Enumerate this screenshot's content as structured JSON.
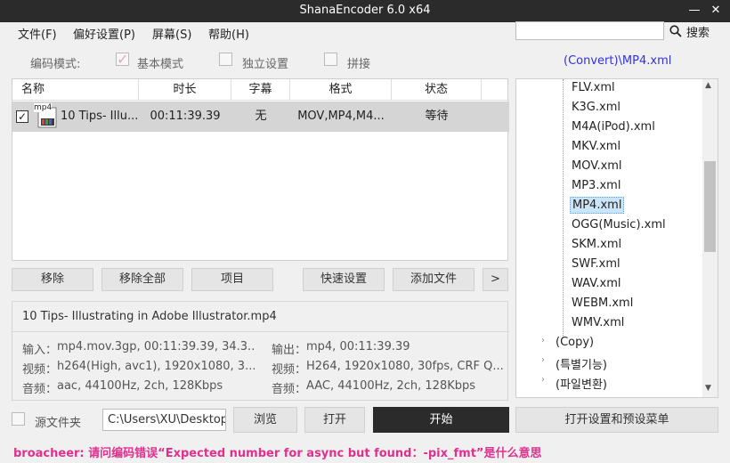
{
  "window": {
    "title": "ShanaEncoder 6.0 x64",
    "minimize": "—",
    "close": "✕"
  },
  "menu": {
    "items": [
      "文件(F)",
      "偏好设置(P)",
      "屏幕(S)",
      "帮助(H)"
    ],
    "search_label": "搜索"
  },
  "mode": {
    "label": "编码模式:",
    "options": [
      {
        "label": "基本模式",
        "checked": true
      },
      {
        "label": "独立设置",
        "checked": false
      },
      {
        "label": "拼接",
        "checked": false
      }
    ]
  },
  "preset_path": "(Convert)\\MP4.xml",
  "table": {
    "headers": [
      "名称",
      "时长",
      "字幕",
      "格式",
      "状态"
    ],
    "rows": [
      {
        "name": "10 Tips- Illu...",
        "duration": "00:11:39.39",
        "subtitle": "无",
        "format": "MOV,MP4,M4...",
        "status": "等待",
        "icon_label": "mp4",
        "checked": true
      }
    ]
  },
  "actions": {
    "remove": "移除",
    "remove_all": "移除全部",
    "item": "项目",
    "quick_settings": "快速设置",
    "add_file": "添加文件",
    "more": ">"
  },
  "info": {
    "filename": "10 Tips- Illustrating in Adobe Illustrator.mp4",
    "input_label": "输入：",
    "input_value": "mp4.mov.3gp, 00:11:39.39, 34.3...",
    "output_label": "输出：",
    "output_value": "mp4, 00:11:39.39",
    "video_label": "视频：",
    "video_in": "h264(High, avc1), 1920x1080, 3...",
    "video_out": "H264, 1920x1080, 30fps, CRF Q...",
    "audio_label": "音频：",
    "audio_in": "aac, 44100Hz, 2ch, 128Kbps",
    "audio_out": "AAC, 44100Hz, 2ch, 128Kbps"
  },
  "tree": {
    "items": [
      "FLV.xml",
      "K3G.xml",
      "M4A(iPod).xml",
      "MKV.xml",
      "MOV.xml",
      "MP3.xml",
      "MP4.xml",
      "OGG(Music).xml",
      "SKM.xml",
      "SWF.xml",
      "WAV.xml",
      "WEBM.xml",
      "WMV.xml"
    ],
    "selected": "MP4.xml",
    "folders": [
      "(Copy)",
      "(특별기능)",
      "(파일변환)"
    ]
  },
  "bottom": {
    "source_folder_label": "源文件夹",
    "source_path": "C:\\Users\\XU\\Desktop",
    "browse": "浏览",
    "open": "打开",
    "start": "开始",
    "open_settings": "打开设置和预设菜单"
  },
  "status": "broacheer: 请问编码错误“Expected number for async but found：-pix_fmt”是什么意思",
  "colors": {
    "titlebar": "#2b2b2b",
    "accent_link": "#3232d8",
    "status_text": "#e0308f",
    "selected_row": "#d5d5d5"
  }
}
